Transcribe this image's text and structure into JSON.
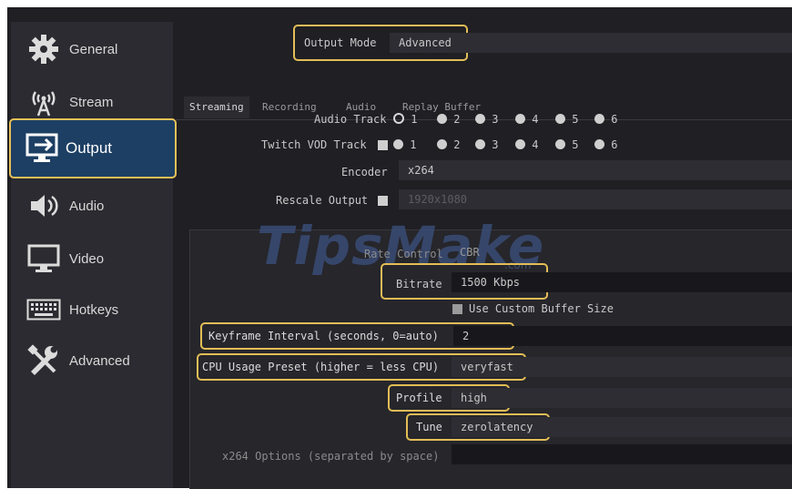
{
  "sidebar": {
    "items": [
      {
        "label": "General",
        "icon": "gear-icon"
      },
      {
        "label": "Stream",
        "icon": "broadcast-icon"
      },
      {
        "label": "Output",
        "icon": "output-icon"
      },
      {
        "label": "Audio",
        "icon": "speaker-icon"
      },
      {
        "label": "Video",
        "icon": "monitor-icon"
      },
      {
        "label": "Hotkeys",
        "icon": "keyboard-icon"
      },
      {
        "label": "Advanced",
        "icon": "tools-icon"
      }
    ]
  },
  "output_mode": {
    "label": "Output Mode",
    "value": "Advanced"
  },
  "tabs": [
    "Streaming",
    "Recording",
    "Audio",
    "Replay Buffer"
  ],
  "audio_track": {
    "label": "Audio Track",
    "options": [
      "1",
      "2",
      "3",
      "4",
      "5",
      "6"
    ],
    "selected": "1"
  },
  "twitch_vod_track": {
    "label": "Twitch VOD Track",
    "options": [
      "1",
      "2",
      "3",
      "4",
      "5",
      "6"
    ]
  },
  "encoder": {
    "label": "Encoder",
    "value": "x264"
  },
  "rescale_output": {
    "label": "Rescale Output",
    "value": "1920x1080"
  },
  "rate_control": {
    "label": "Rate Control",
    "value": "CBR"
  },
  "bitrate": {
    "label": "Bitrate",
    "value": "1500 Kbps"
  },
  "custom_buffer": {
    "label": "Use Custom Buffer Size"
  },
  "keyframe_interval": {
    "label": "Keyframe Interval (seconds, 0=auto)",
    "value": "2"
  },
  "cpu_preset": {
    "label": "CPU Usage Preset (higher = less CPU)",
    "value": "veryfast"
  },
  "profile": {
    "label": "Profile",
    "value": "high"
  },
  "tune": {
    "label": "Tune",
    "value": "zerolatency"
  },
  "x264_options": {
    "label": "x264 Options (separated by space)",
    "value": ""
  },
  "watermark": {
    "text": "TipsMake",
    "domain": ".com"
  },
  "colors": {
    "accent_highlight": "#e3bd56",
    "active_bg": "#1d3f64",
    "panel_bg": "#1f1f24"
  }
}
